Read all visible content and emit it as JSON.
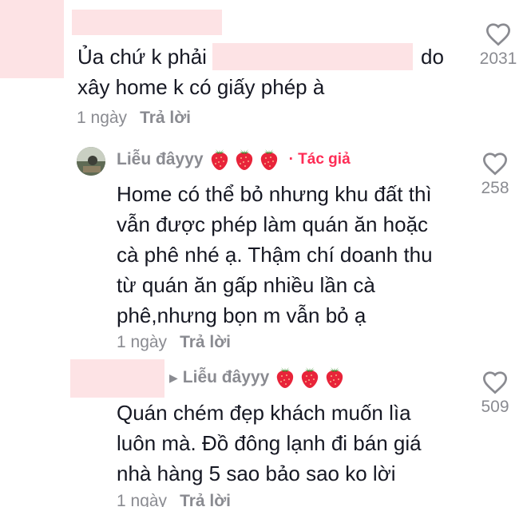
{
  "comments": [
    {
      "text_before": "Ủa chứ k phải",
      "text_after": "do",
      "text_line2": "xây home k có giấy phép à",
      "time": "1 ngày",
      "reply_label": "Trả lời",
      "likes": "2031"
    },
    {
      "username": "Liễu đâyyy",
      "author_badge": "· Tác giả",
      "text_lines": [
        "Home có thể bỏ nhưng khu đất thì",
        "vẫn được phép làm quán ăn hoặc",
        "cà phê nhé ạ. Thậm chí doanh thu",
        "từ quán ăn gấp nhiều lần cà",
        "phê,nhưng bọn m vẫn bỏ ạ"
      ],
      "time": "1 ngày",
      "reply_label": "Trả lời",
      "likes": "258"
    },
    {
      "reply_to": "Liễu đâyyy",
      "text_lines": [
        "Quán chém đẹp khách muốn lìa",
        "luôn mà. Đồ đông lạnh đi bán giá",
        "nhà hàng 5 sao bảo sao ko lời"
      ],
      "time": "1 ngày",
      "reply_label": "Trả lời",
      "likes": "509"
    }
  ],
  "icons": {
    "like": "heart-outline-icon",
    "emoji": "strawberry-icon",
    "reply_arrow": "caret-right-icon"
  },
  "colors": {
    "text": "#161823",
    "muted": "#8a8b91",
    "author_badge": "#fe2c55",
    "redaction": "#fde3e5",
    "strawberry": "#e8243a"
  }
}
